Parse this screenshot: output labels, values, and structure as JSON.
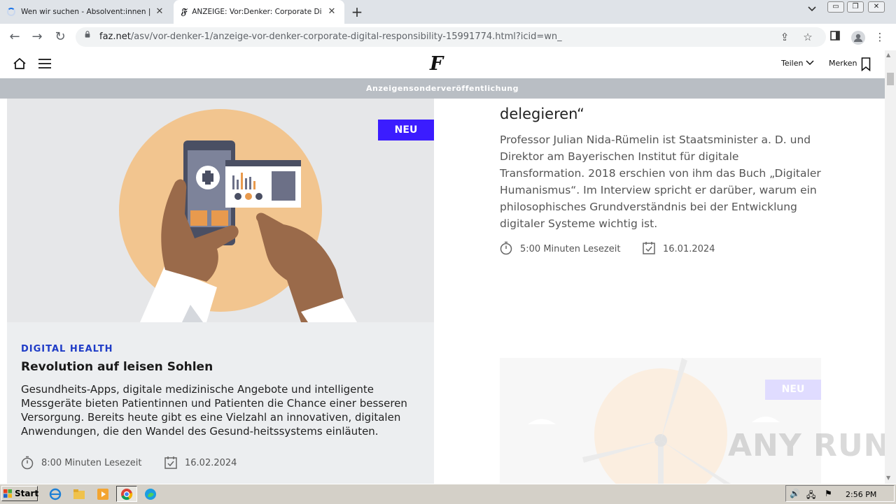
{
  "browser": {
    "tabs": [
      {
        "title": "Wen wir suchen - Absolvent:innen | ",
        "active": false
      },
      {
        "title": "ANZEIGE: Vor:Denker: Corporate Di",
        "active": true
      }
    ],
    "url_host": "faz.net",
    "url_path": "/asv/vor-denker-1/anzeige-vor-denker-corporate-digital-responsibility-15991774.html?icid=wn_"
  },
  "header": {
    "logo": "F",
    "share_label": "Teilen",
    "bookmark_label": "Merken",
    "ad_banner": "Anzeigensonderveröffentlichung"
  },
  "articles": {
    "left": {
      "badge": "NEU",
      "category": "DIGITAL HEALTH",
      "title": "Revolution auf leisen Sohlen",
      "description": "Gesundheits-Apps, digitale medizinische Angebote und intelligente Messgeräte bieten Patientinnen und Patienten die Chance einer besseren Versorgung. Bereits heute gibt es eine Vielzahl an innovativen, digitalen Anwendungen, die den Wandel des Gesund-heitssystems einläuten.",
      "reading_time": "8:00 Minuten Lesezeit",
      "date": "16.02.2024"
    },
    "right": {
      "title_fragment": "delegieren“",
      "description": "Professor Julian Nida-Rümelin ist Staatsminister a. D. und Direktor am Bayerischen Institut für digitale Transformation. 2018 erschien von ihm das Buch „Digitaler Humanismus“. Im Interview spricht er darüber, warum ein philosophisches Grundverständnis bei der Entwicklung digitaler Systeme wichtig ist.",
      "reading_time": "5:00 Minuten Lesezeit",
      "date": "16.01.2024",
      "next_badge": "NEU"
    }
  },
  "watermark": "ANY RUN",
  "taskbar": {
    "start_label": "Start",
    "clock": "2:56 PM"
  },
  "colors": {
    "accent_blue": "#3b1cff",
    "category_blue": "#1f3cc7",
    "banner_gray": "#b9bec4"
  }
}
